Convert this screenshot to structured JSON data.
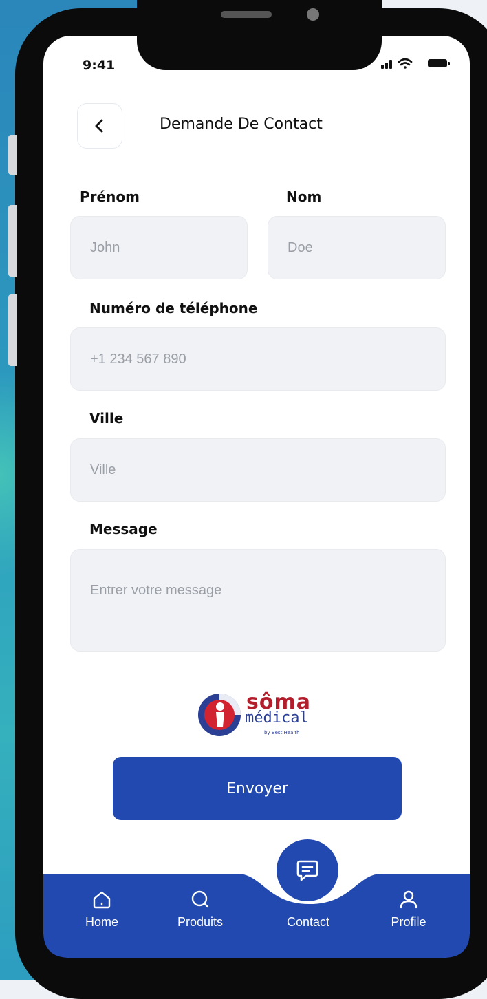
{
  "status_bar": {
    "time": "9:41"
  },
  "header": {
    "title": "Demande De Contact"
  },
  "form": {
    "first_name": {
      "label": "Prénom",
      "placeholder": "John"
    },
    "last_name": {
      "label": "Nom",
      "placeholder": "Doe"
    },
    "phone": {
      "label": "Numéro de téléphone",
      "placeholder": "+1 234 567 890"
    },
    "city": {
      "label": "Ville",
      "placeholder": "Ville"
    },
    "message": {
      "label": "Message",
      "placeholder": "Entrer votre message"
    }
  },
  "logo": {
    "line1": "sôma",
    "line2": "médical",
    "line3": "by Best Health"
  },
  "submit_label": "Envoyer",
  "tabbar": {
    "items": [
      {
        "label": "Home",
        "icon": "home-icon"
      },
      {
        "label": "Produits",
        "icon": "search-icon"
      },
      {
        "label": "Contact",
        "icon": "chat-icon"
      },
      {
        "label": "Profile",
        "icon": "user-icon"
      }
    ]
  },
  "colors": {
    "primary": "#2249b0",
    "field_bg": "#f1f2f5",
    "brand_red": "#b31e2d"
  }
}
